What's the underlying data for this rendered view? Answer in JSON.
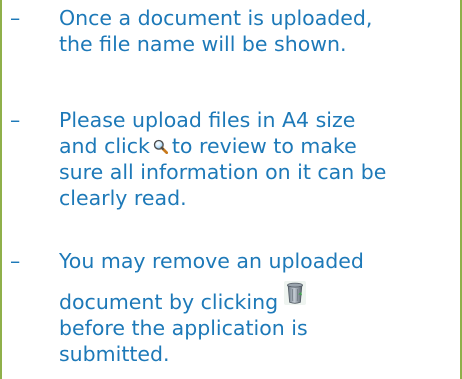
{
  "dash": "–",
  "notes": [
    {
      "line1": "Once a document is uploaded,",
      "line2": "the file name will be shown."
    },
    {
      "line1": "Please upload files in A4 size",
      "line2_before": "and click",
      "line2_after": "to review to make",
      "line3": "sure all information on it can be",
      "line4": "clearly read."
    },
    {
      "line1": "You may remove an uploaded",
      "line2": "document by clicking",
      "line3": "before the application is",
      "line4": "submitted."
    }
  ],
  "icons": {
    "review": "magnifier-icon",
    "remove": "recycle-bin-icon"
  },
  "colors": {
    "text": "#1d79b8",
    "border": "#8fb04a"
  }
}
